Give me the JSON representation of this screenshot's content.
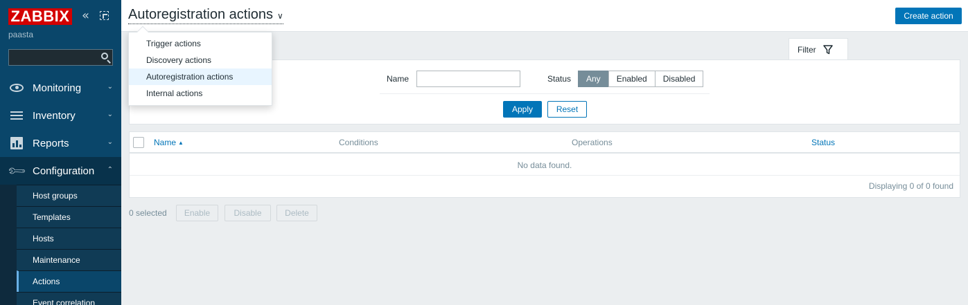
{
  "sidebar": {
    "logo": "ZABBIX",
    "server_name": "paasta",
    "search_value": "",
    "menu": [
      {
        "label": "Monitoring",
        "icon": "eye-icon",
        "chevron": "⌄"
      },
      {
        "label": "Inventory",
        "icon": "list-icon",
        "chevron": "⌄"
      },
      {
        "label": "Reports",
        "icon": "bar-chart-icon",
        "chevron": "⌄"
      },
      {
        "label": "Configuration",
        "icon": "wrench-icon",
        "chevron": "⌃"
      }
    ],
    "submenu": [
      {
        "label": "Host groups"
      },
      {
        "label": "Templates"
      },
      {
        "label": "Hosts"
      },
      {
        "label": "Maintenance"
      },
      {
        "label": "Actions"
      },
      {
        "label": "Event correlation"
      }
    ]
  },
  "header": {
    "title": "Autoregistration actions",
    "create_button": "Create action"
  },
  "dropdown": {
    "items": [
      {
        "label": "Trigger actions"
      },
      {
        "label": "Discovery actions"
      },
      {
        "label": "Autoregistration actions"
      },
      {
        "label": "Internal actions"
      }
    ]
  },
  "filter": {
    "tab_label": "Filter",
    "name_label": "Name",
    "name_value": "",
    "status_label": "Status",
    "status_options": [
      "Any",
      "Enabled",
      "Disabled"
    ],
    "apply_label": "Apply",
    "reset_label": "Reset"
  },
  "table": {
    "columns": [
      "Name",
      "Conditions",
      "Operations",
      "Status"
    ],
    "sort_indicator": "▲",
    "empty_text": "No data found.",
    "paging": "Displaying 0 of 0 found"
  },
  "mass_actions": {
    "selected": "0 selected",
    "buttons": [
      "Enable",
      "Disable",
      "Delete"
    ]
  },
  "colors": {
    "sidebar_bg": "#0a466a",
    "logo_bg": "#d40000",
    "primary": "#0275b8",
    "segment_active": "#768d99"
  }
}
